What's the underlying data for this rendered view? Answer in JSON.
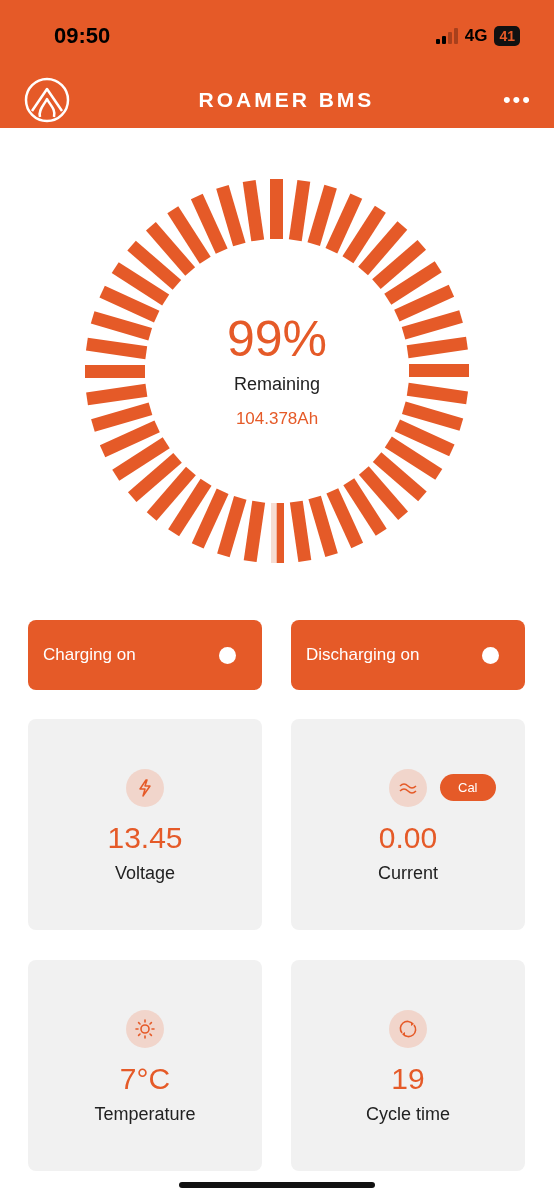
{
  "status_bar": {
    "time": "09:50",
    "network": "4G",
    "battery": "41"
  },
  "header": {
    "title": "ROAMER BMS",
    "menu": "•••"
  },
  "gauge": {
    "percent": "99%",
    "label": "Remaining",
    "capacity": "104.378Ah"
  },
  "toggles": [
    {
      "label": "Charging on",
      "on": true
    },
    {
      "label": "Discharging on",
      "on": true
    }
  ],
  "cards": [
    {
      "kind": "voltage",
      "value": "13.45",
      "label": "Voltage"
    },
    {
      "kind": "current",
      "value": "0.00",
      "label": "Current",
      "badge": "Cal"
    },
    {
      "kind": "temperature",
      "value": "7°C",
      "label": "Temperature"
    },
    {
      "kind": "cycles",
      "value": "19",
      "label": "Cycle time"
    }
  ]
}
